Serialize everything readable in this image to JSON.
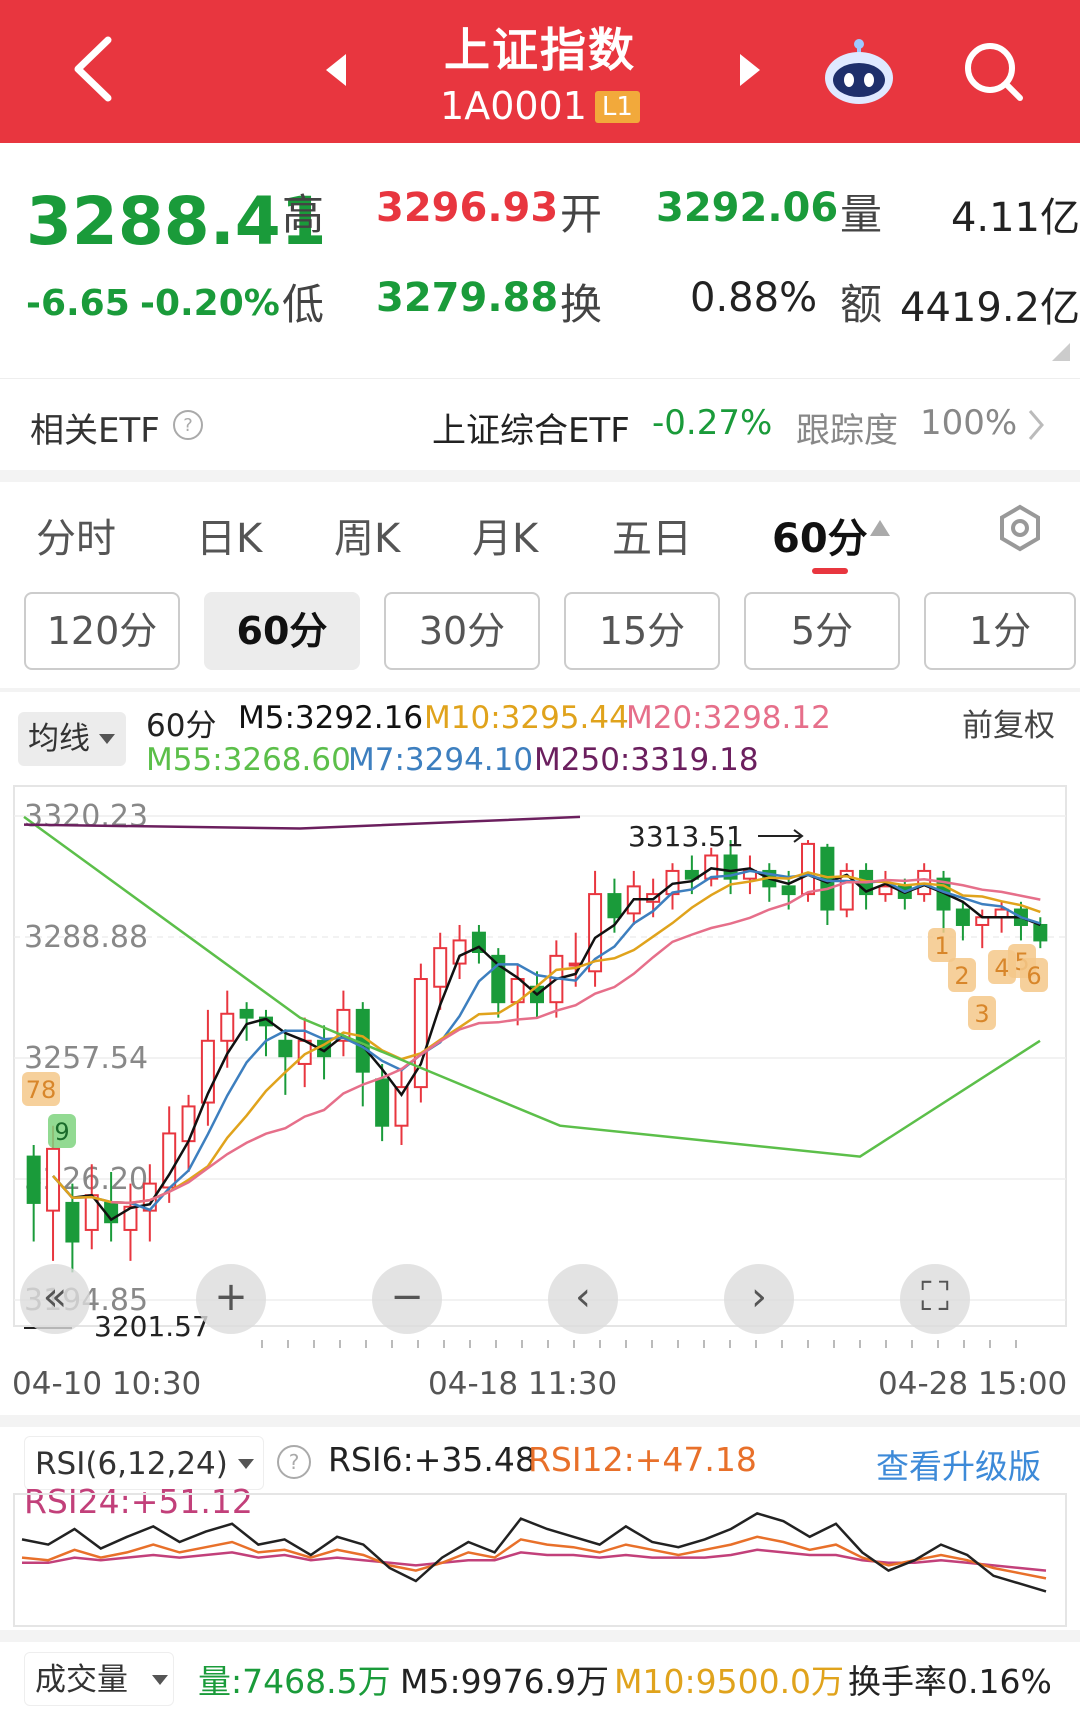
{
  "header": {
    "title": "上证指数",
    "code": "1A0001",
    "level_badge": "L1"
  },
  "quote": {
    "price": "3288.41",
    "change": "-6.65",
    "change_pct": "-0.20%",
    "high_label": "高",
    "high": "3296.93",
    "low_label": "低",
    "low": "3279.88",
    "open_label": "开",
    "open": "3292.06",
    "turnover_label": "换",
    "turnover": "0.88%",
    "volume_label": "量",
    "volume": "4.11亿",
    "amount_label": "额",
    "amount": "4419.2亿"
  },
  "etf": {
    "label": "相关ETF",
    "name": "上证综合ETF",
    "change": "-0.27%",
    "tracking_label": "跟踪度",
    "tracking": "100%"
  },
  "period_tabs": [
    "分时",
    "日K",
    "周K",
    "月K",
    "五日",
    "60分"
  ],
  "active_period": "60分",
  "minute_pills": [
    "120分",
    "60分",
    "30分",
    "15分",
    "5分",
    "1分"
  ],
  "active_pill": "60分",
  "ma_legend": {
    "dropdown": "均线",
    "period": "60分",
    "m5": "M5:3292.16",
    "m10": "M10:3295.44",
    "m20": "M20:3298.12",
    "adjust": "前复权",
    "m55": "M55:3268.60",
    "m7": "M7:3294.10",
    "m250": "M250:3319.18"
  },
  "colors": {
    "up": "#e8363f",
    "down": "#1a9b3a",
    "m5": "#111111",
    "m10": "#e0a31c",
    "m20": "#e66f8a",
    "m55": "#5cbf4a",
    "m7": "#3d7fbf",
    "m250": "#6b1f5e"
  },
  "chart_data": [
    {
      "type": "candlestick",
      "y_ticks": [
        "3320.23",
        "3288.88",
        "3257.54",
        "3226.20",
        "3194.85"
      ],
      "ylim": [
        3194.85,
        3320.23
      ],
      "x_ticks": [
        "04-10 10:30",
        "04-18 11:30",
        "04-28 15:00"
      ],
      "max_label": "3313.51",
      "min_label": "3201.57",
      "signal_badges": [
        "78",
        "9",
        "1",
        "2",
        "3",
        "4",
        "5",
        "6"
      ],
      "candles": [
        [
          3232,
          3220,
          3235,
          3210
        ],
        [
          3218,
          3234,
          3240,
          3205
        ],
        [
          3220,
          3210,
          3225,
          3202
        ],
        [
          3213,
          3222,
          3230,
          3208
        ],
        [
          3220,
          3215,
          3228,
          3210
        ],
        [
          3213,
          3219,
          3225,
          3205
        ],
        [
          3218,
          3225,
          3230,
          3210
        ],
        [
          3224,
          3238,
          3245,
          3220
        ],
        [
          3236,
          3245,
          3248,
          3228
        ],
        [
          3246,
          3262,
          3270,
          3240
        ],
        [
          3262,
          3269,
          3275,
          3255
        ],
        [
          3270,
          3268,
          3272,
          3262
        ],
        [
          3268,
          3266,
          3270,
          3258
        ],
        [
          3262,
          3258,
          3265,
          3248
        ],
        [
          3256,
          3262,
          3268,
          3250
        ],
        [
          3262,
          3258,
          3266,
          3252
        ],
        [
          3262,
          3270,
          3275,
          3258
        ],
        [
          3270,
          3254,
          3272,
          3245
        ],
        [
          3252,
          3240,
          3256,
          3236
        ],
        [
          3240,
          3250,
          3255,
          3235
        ],
        [
          3250,
          3278,
          3282,
          3246
        ],
        [
          3276,
          3286,
          3290,
          3270
        ],
        [
          3282,
          3288,
          3292,
          3278
        ],
        [
          3290,
          3285,
          3292,
          3282
        ],
        [
          3284,
          3272,
          3286,
          3268
        ],
        [
          3272,
          3278,
          3282,
          3266
        ],
        [
          3276,
          3272,
          3280,
          3268
        ],
        [
          3272,
          3284,
          3288,
          3268
        ],
        [
          3282,
          3282,
          3290,
          3276
        ],
        [
          3280,
          3300,
          3306,
          3276
        ],
        [
          3300,
          3294,
          3304,
          3290
        ],
        [
          3295,
          3302,
          3306,
          3292
        ],
        [
          3298,
          3300,
          3304,
          3294
        ],
        [
          3300,
          3306,
          3308,
          3296
        ],
        [
          3306,
          3304,
          3310,
          3300
        ],
        [
          3304,
          3310,
          3312,
          3302
        ],
        [
          3310,
          3304,
          3314,
          3300
        ],
        [
          3304,
          3306,
          3310,
          3300
        ],
        [
          3306,
          3302,
          3308,
          3298
        ],
        [
          3302,
          3300,
          3306,
          3296
        ],
        [
          3300,
          3313,
          3314,
          3298
        ],
        [
          3312,
          3296,
          3313,
          3292
        ],
        [
          3296,
          3306,
          3308,
          3294
        ],
        [
          3306,
          3300,
          3308,
          3296
        ],
        [
          3300,
          3302,
          3306,
          3298
        ],
        [
          3302,
          3299,
          3304,
          3296
        ],
        [
          3300,
          3306,
          3308,
          3298
        ],
        [
          3304,
          3296,
          3306,
          3290
        ],
        [
          3296,
          3292,
          3298,
          3288
        ],
        [
          3292,
          3294,
          3296,
          3286
        ],
        [
          3294,
          3296,
          3298,
          3290
        ],
        [
          3296,
          3292,
          3298,
          3288
        ],
        [
          3292,
          3288,
          3294,
          3286
        ]
      ]
    },
    {
      "type": "line",
      "title": "RSI(6,12,24)",
      "series": [
        {
          "name": "RSI6:+35.48"
        },
        {
          "name": "RSI12:+47.18"
        },
        {
          "name": "RSI24:+51.12"
        }
      ]
    }
  ],
  "rsi": {
    "dropdown": "RSI(6,12,24)",
    "rsi6": "RSI6:+35.48",
    "rsi12": "RSI12:+47.18",
    "rsi24": "RSI24:+51.12",
    "upgrade": "查看升级版"
  },
  "volume": {
    "dropdown": "成交量",
    "vol": "量:7468.5万",
    "m5": "M5:9976.9万",
    "m10": "M10:9500.0万",
    "turnover": "换手率0.16%"
  }
}
